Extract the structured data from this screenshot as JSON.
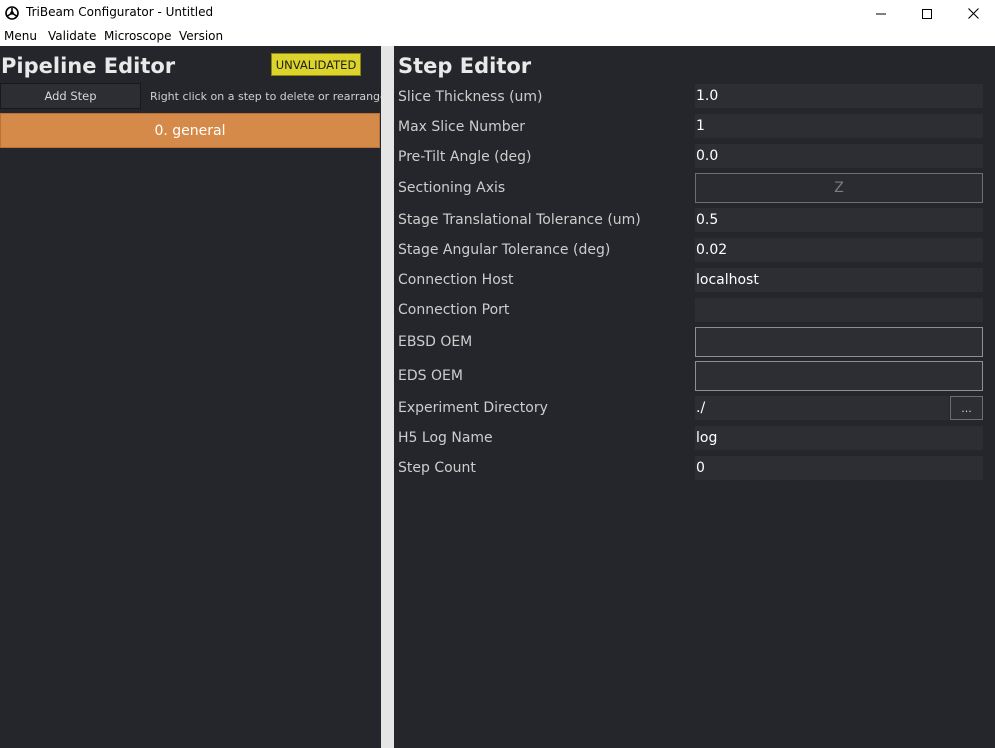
{
  "window": {
    "title": "TriBeam Configurator - Untitled",
    "icon": "tribeam-app-icon"
  },
  "menubar": {
    "items": [
      "Menu",
      "Validate",
      "Microscope",
      "Version"
    ]
  },
  "pipeline_editor": {
    "title": "Pipeline Editor",
    "status_badge": "UNVALIDATED",
    "status_color": "#dcd42c",
    "add_step_label": "Add Step",
    "hint": "Right click on a step to delete or rearrange",
    "steps": [
      {
        "label": "0. general",
        "color": "#d68a4a"
      }
    ]
  },
  "step_editor": {
    "title": "Step Editor",
    "fields": [
      {
        "label": "Slice Thickness (um)",
        "value": "1.0"
      },
      {
        "label": "Max Slice Number",
        "value": "1"
      },
      {
        "label": "Pre-Tilt Angle (deg)",
        "value": "0.0"
      },
      {
        "label": "Sectioning Axis",
        "value": "Z"
      },
      {
        "label": "Stage Translational Tolerance (um)",
        "value": "0.5"
      },
      {
        "label": "Stage Angular Tolerance (deg)",
        "value": "0.02"
      },
      {
        "label": "Connection Host",
        "value": "localhost"
      },
      {
        "label": "Connection Port",
        "value": ""
      },
      {
        "label": "EBSD OEM",
        "value": ""
      },
      {
        "label": "EDS OEM",
        "value": ""
      },
      {
        "label": "Experiment Directory",
        "value": "./",
        "button_label": "..."
      },
      {
        "label": "H5 Log Name",
        "value": "log"
      },
      {
        "label": "Step Count",
        "value": "0"
      }
    ]
  }
}
